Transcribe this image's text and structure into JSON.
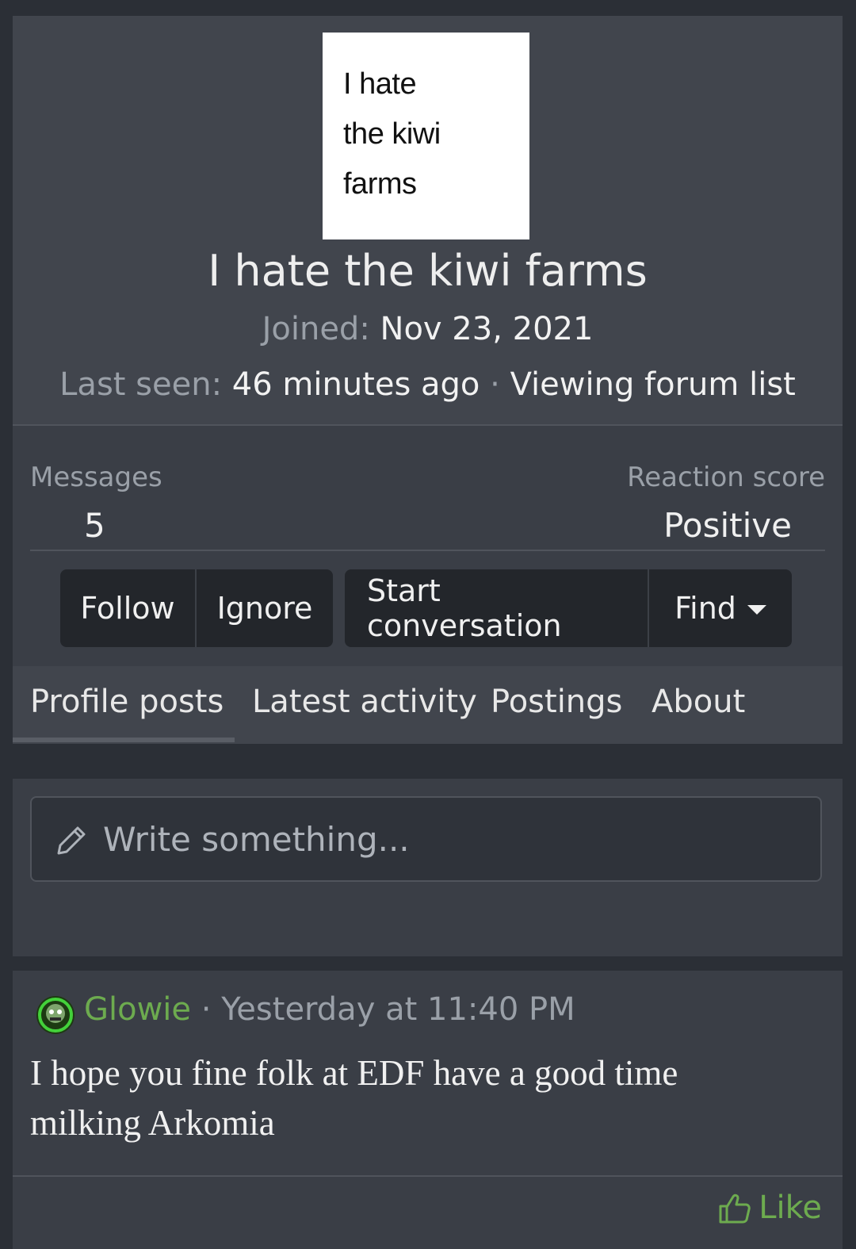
{
  "profile": {
    "avatar_lines": [
      "I hate",
      "the kiwi",
      "farms"
    ],
    "username": "I hate the kiwi farms",
    "joined_label": "Joined:",
    "joined_value": "Nov 23, 2021",
    "last_seen_label": "Last seen:",
    "last_seen_value": "46 minutes ago",
    "last_seen_separator": "·",
    "last_seen_activity": "Viewing forum list"
  },
  "stats": {
    "messages_label": "Messages",
    "messages_value": "5",
    "reaction_label": "Reaction score",
    "reaction_value": "Positive"
  },
  "actions": {
    "follow": "Follow",
    "ignore": "Ignore",
    "start_conversation": "Start conversation",
    "find": "Find"
  },
  "tabs": [
    "Profile posts",
    "Latest activity",
    "Postings",
    "About"
  ],
  "composer": {
    "placeholder": "Write something..."
  },
  "post": {
    "author": "Glowie",
    "separator": "·",
    "time": "Yesterday at 11:40 PM",
    "body": "I hope you fine folk at EDF have a good time milking Arkomia",
    "like_label": "Like"
  },
  "colors": {
    "background": "#2b2f36",
    "card": "#3a3e46",
    "button": "#23262b",
    "accent_green": "#6dab4f"
  },
  "icons": {
    "composer": "pencil-icon",
    "like": "thumbs-up-icon",
    "find_dropdown": "caret-down-icon"
  }
}
